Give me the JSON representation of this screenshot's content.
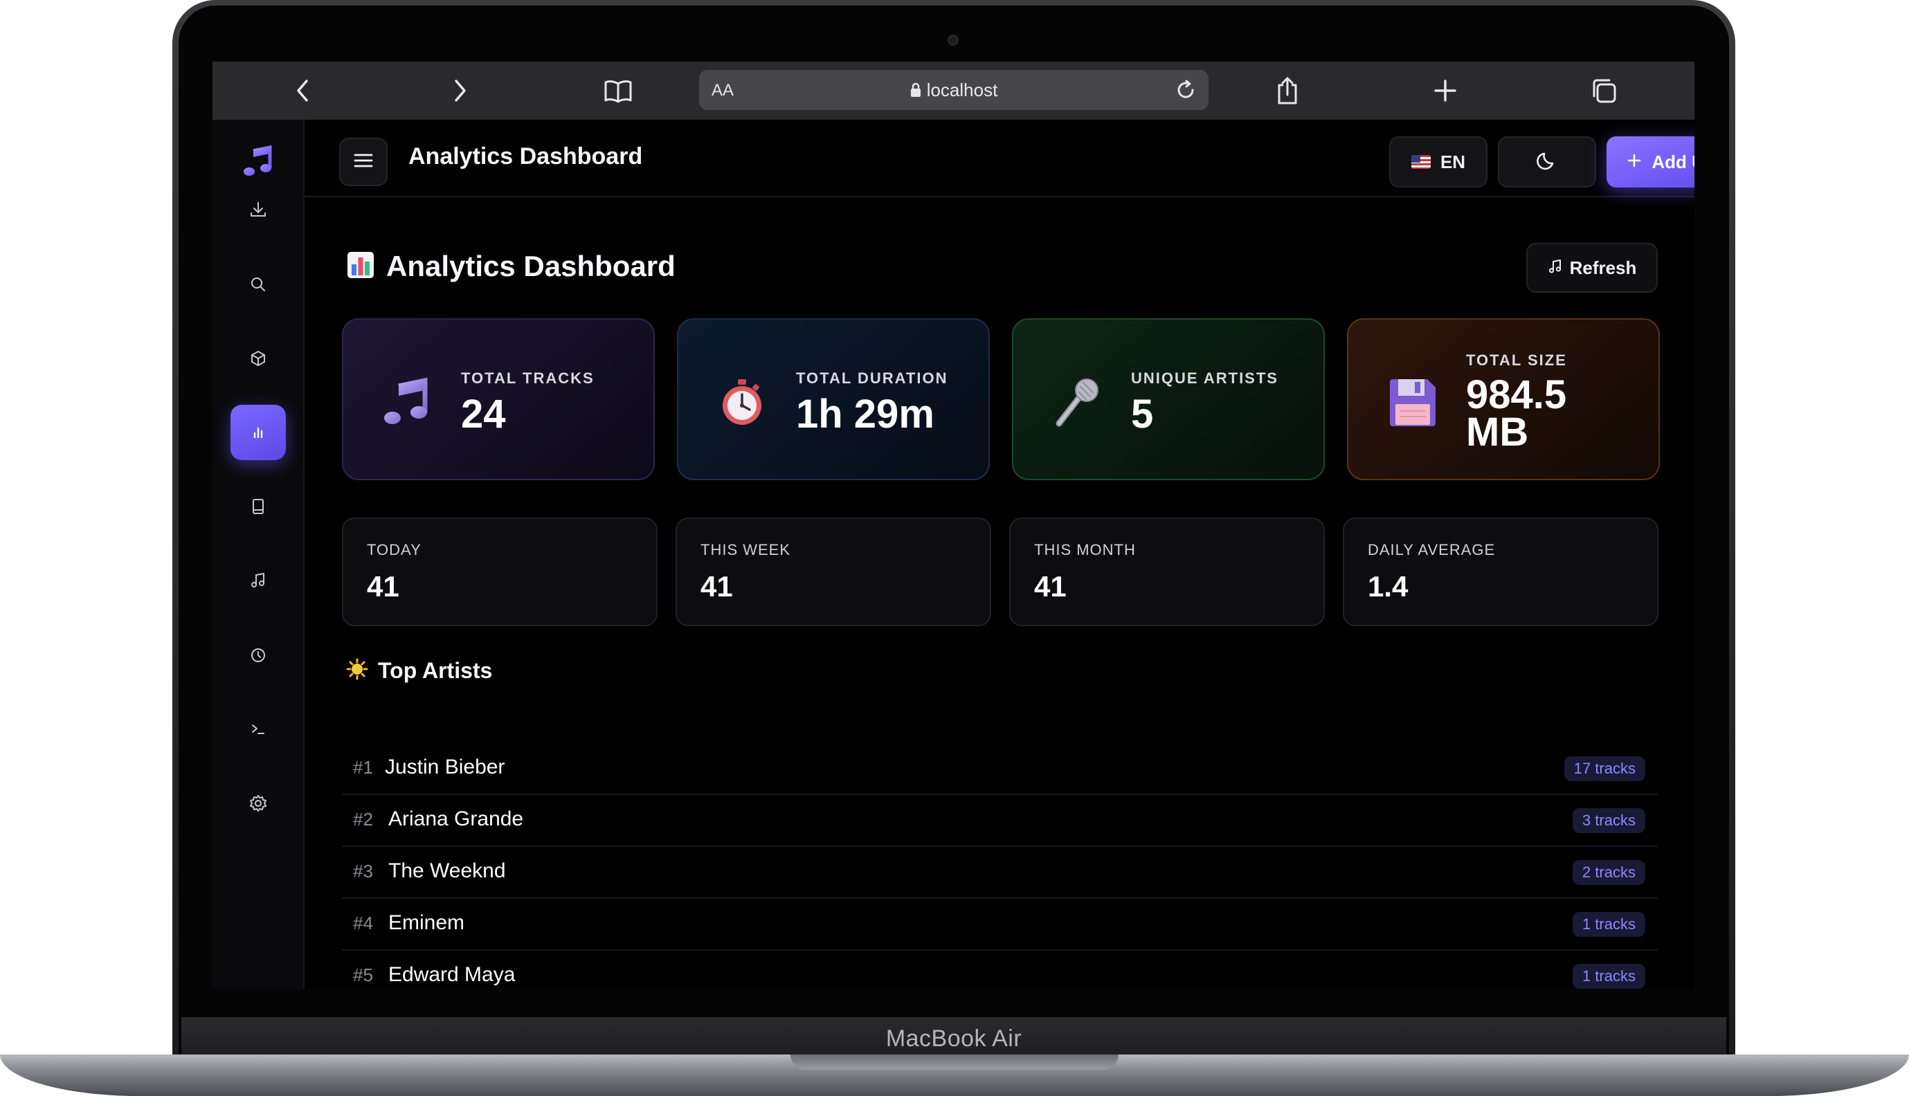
{
  "device": {
    "label": "MacBook Air"
  },
  "browser": {
    "address_prefix": "AA",
    "url": "localhost"
  },
  "header": {
    "title": "Analytics Dashboard",
    "language": "EN",
    "add_url_label": "Add URL"
  },
  "page": {
    "title": "Analytics Dashboard",
    "refresh_label": "Refresh"
  },
  "stats": [
    {
      "label": "TOTAL TRACKS",
      "value": "24",
      "icon": "music-note-icon"
    },
    {
      "label": "TOTAL DURATION",
      "value": "1h 29m",
      "icon": "stopwatch-icon"
    },
    {
      "label": "UNIQUE ARTISTS",
      "value": "5",
      "icon": "microphone-icon"
    },
    {
      "label": "TOTAL SIZE",
      "value": "984.5 MB",
      "icon": "floppy-disk-icon"
    }
  ],
  "periods": [
    {
      "label": "TODAY",
      "value": "41"
    },
    {
      "label": "THIS WEEK",
      "value": "41"
    },
    {
      "label": "THIS MONTH",
      "value": "41"
    },
    {
      "label": "DAILY AVERAGE",
      "value": "1.4"
    }
  ],
  "top_artists": {
    "title": "Top Artists",
    "items": [
      {
        "rank": "#1",
        "name": "Justin Bieber",
        "tracks": "17 tracks"
      },
      {
        "rank": "#2",
        "name": "Ariana Grande",
        "tracks": "3 tracks"
      },
      {
        "rank": "#3",
        "name": "The Weeknd",
        "tracks": "2 tracks"
      },
      {
        "rank": "#4",
        "name": "Eminem",
        "tracks": "1 tracks"
      },
      {
        "rank": "#5",
        "name": "Edward Maya",
        "tracks": "1 tracks"
      }
    ]
  },
  "sidebar": {
    "items": [
      "logo",
      "downloads",
      "search",
      "packages",
      "analytics",
      "library",
      "music",
      "history",
      "terminal",
      "settings"
    ],
    "active": "analytics"
  },
  "colors": {
    "accent": "#6b56f5",
    "background": "#000000",
    "badge_text": "#8f86ff"
  }
}
